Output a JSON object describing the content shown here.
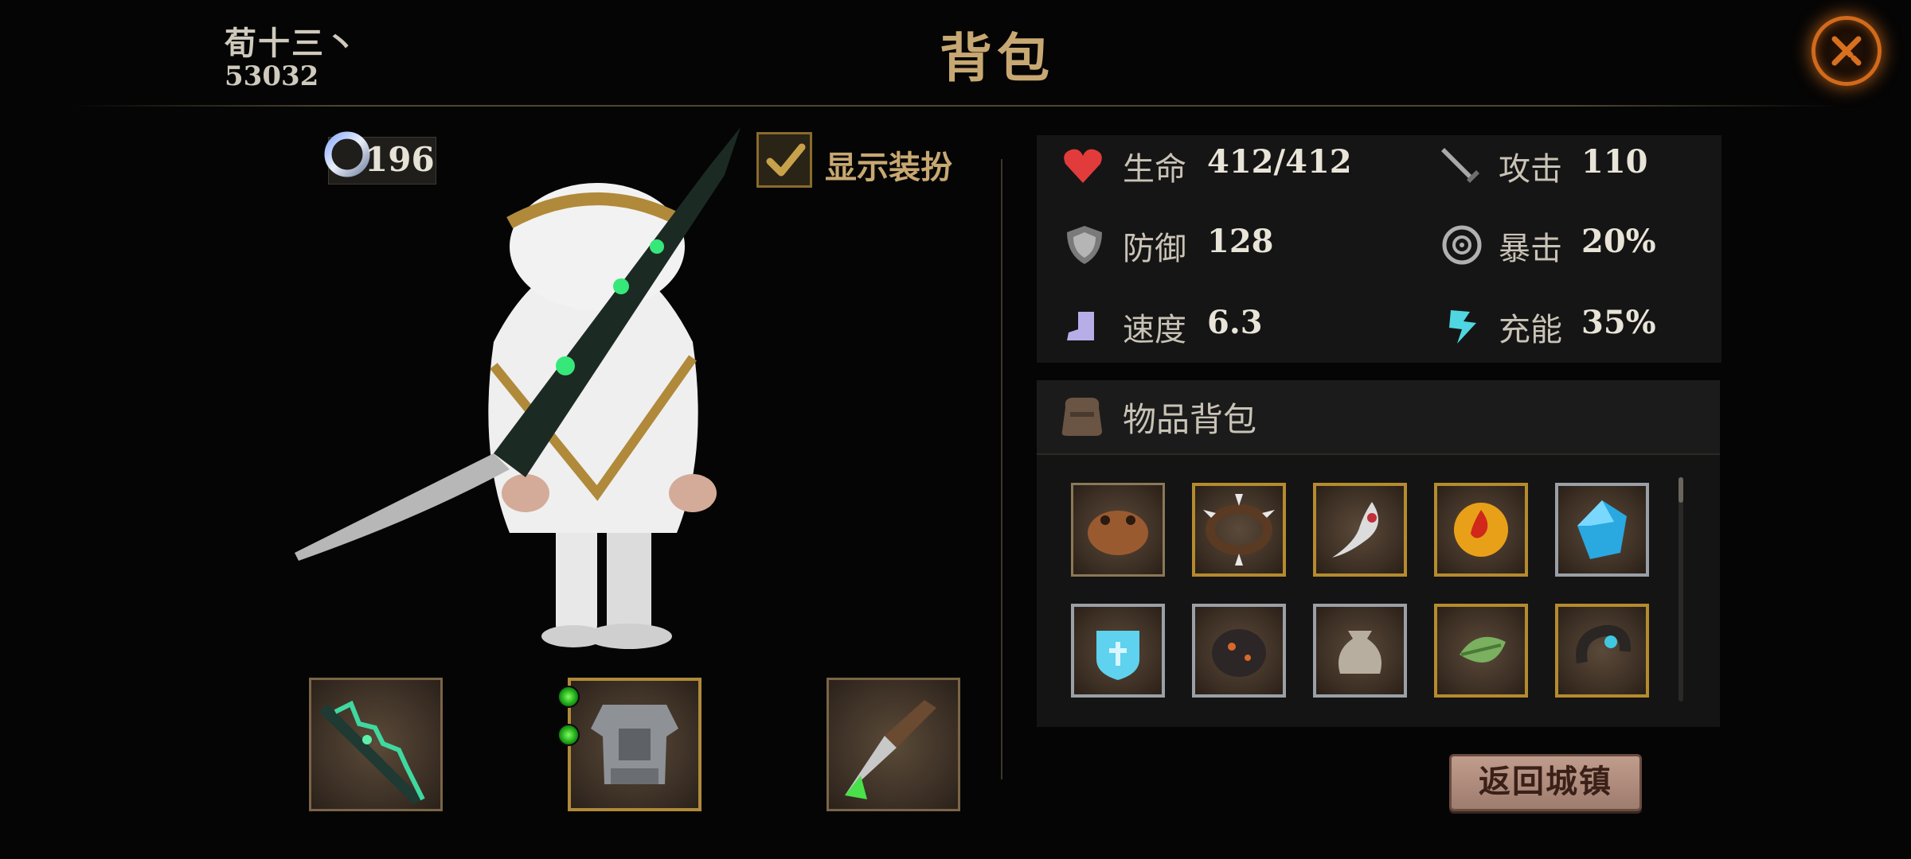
{
  "header": {
    "player_name": "荀十三丶",
    "player_id": "53032",
    "title": "背包"
  },
  "currency": {
    "value": "196",
    "icon": "ring-icon"
  },
  "outfit_toggle": {
    "label": "显示装扮",
    "checked": true
  },
  "stats": [
    {
      "label": "生命",
      "value": "412/412",
      "icon": "heart-icon",
      "color": "#e23b3b"
    },
    {
      "label": "攻击",
      "value": "110",
      "icon": "sword-icon",
      "color": "#9a9a9a"
    },
    {
      "label": "防御",
      "value": "128",
      "icon": "shield-icon",
      "color": "#b0b0b0"
    },
    {
      "label": "暴击",
      "value": "20%",
      "icon": "crit-icon",
      "color": "#b0b0b0"
    },
    {
      "label": "速度",
      "value": "6.3",
      "icon": "boot-icon",
      "color": "#b7aee8"
    },
    {
      "label": "充能",
      "value": "35%",
      "icon": "energy-icon",
      "color": "#4fd6e0"
    }
  ],
  "inventory": {
    "title": "物品背包",
    "items": [
      {
        "icon": "toad-icon",
        "frame": "brown"
      },
      {
        "icon": "spiked-collar-icon",
        "frame": "gold"
      },
      {
        "icon": "claw-pendant-icon",
        "frame": "gold"
      },
      {
        "icon": "fire-coin-icon",
        "frame": "gold"
      },
      {
        "icon": "blue-gem-icon",
        "frame": "silver"
      },
      {
        "icon": "ice-crest-icon",
        "frame": "silver"
      },
      {
        "icon": "lava-rock-icon",
        "frame": "silver"
      },
      {
        "icon": "pouch-icon",
        "frame": "silver"
      },
      {
        "icon": "leaf-amulet-icon",
        "frame": "gold"
      },
      {
        "icon": "horn-ring-icon",
        "frame": "gold"
      }
    ]
  },
  "equipment": [
    {
      "icon": "jade-sword-icon",
      "frame": "brown"
    },
    {
      "icon": "armor-icon",
      "frame": "gold",
      "gems": 2
    },
    {
      "icon": "dagger-icon",
      "frame": "brown"
    }
  ],
  "return_button": {
    "label": "返回城镇"
  }
}
